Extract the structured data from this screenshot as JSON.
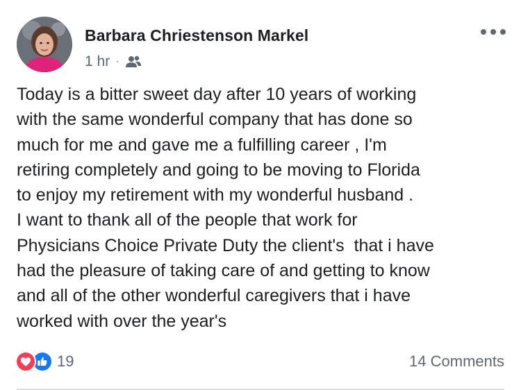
{
  "post": {
    "author": "Barbara Chriestenson Markel",
    "time": "1 hr",
    "separator": "·",
    "privacy_icon": "friends-icon",
    "more_icon": "more-options-icon",
    "body_lines": [
      "Today is a bitter sweet day after 10 years of working",
      "with the same wonderful company that has done so",
      "much for me and gave me a fulfilling career , I'm",
      "retiring completely and going to be moving to Florida",
      "to enjoy my retirement with my wonderful husband .",
      "I want to thank all of the people that work for",
      "Physicians Choice Private Duty the client's  that i have",
      "had the pleasure of taking care of and getting to know",
      "and all of the other wonderful caregivers that i have",
      "worked with over the year's"
    ]
  },
  "footer": {
    "reactions": [
      "love",
      "like"
    ],
    "reaction_count": "19",
    "comments": "14 Comments"
  },
  "colors": {
    "love": "#f33e58",
    "like": "#1877f2",
    "secondary_text": "#606770",
    "primary_text": "#1c1e21"
  }
}
